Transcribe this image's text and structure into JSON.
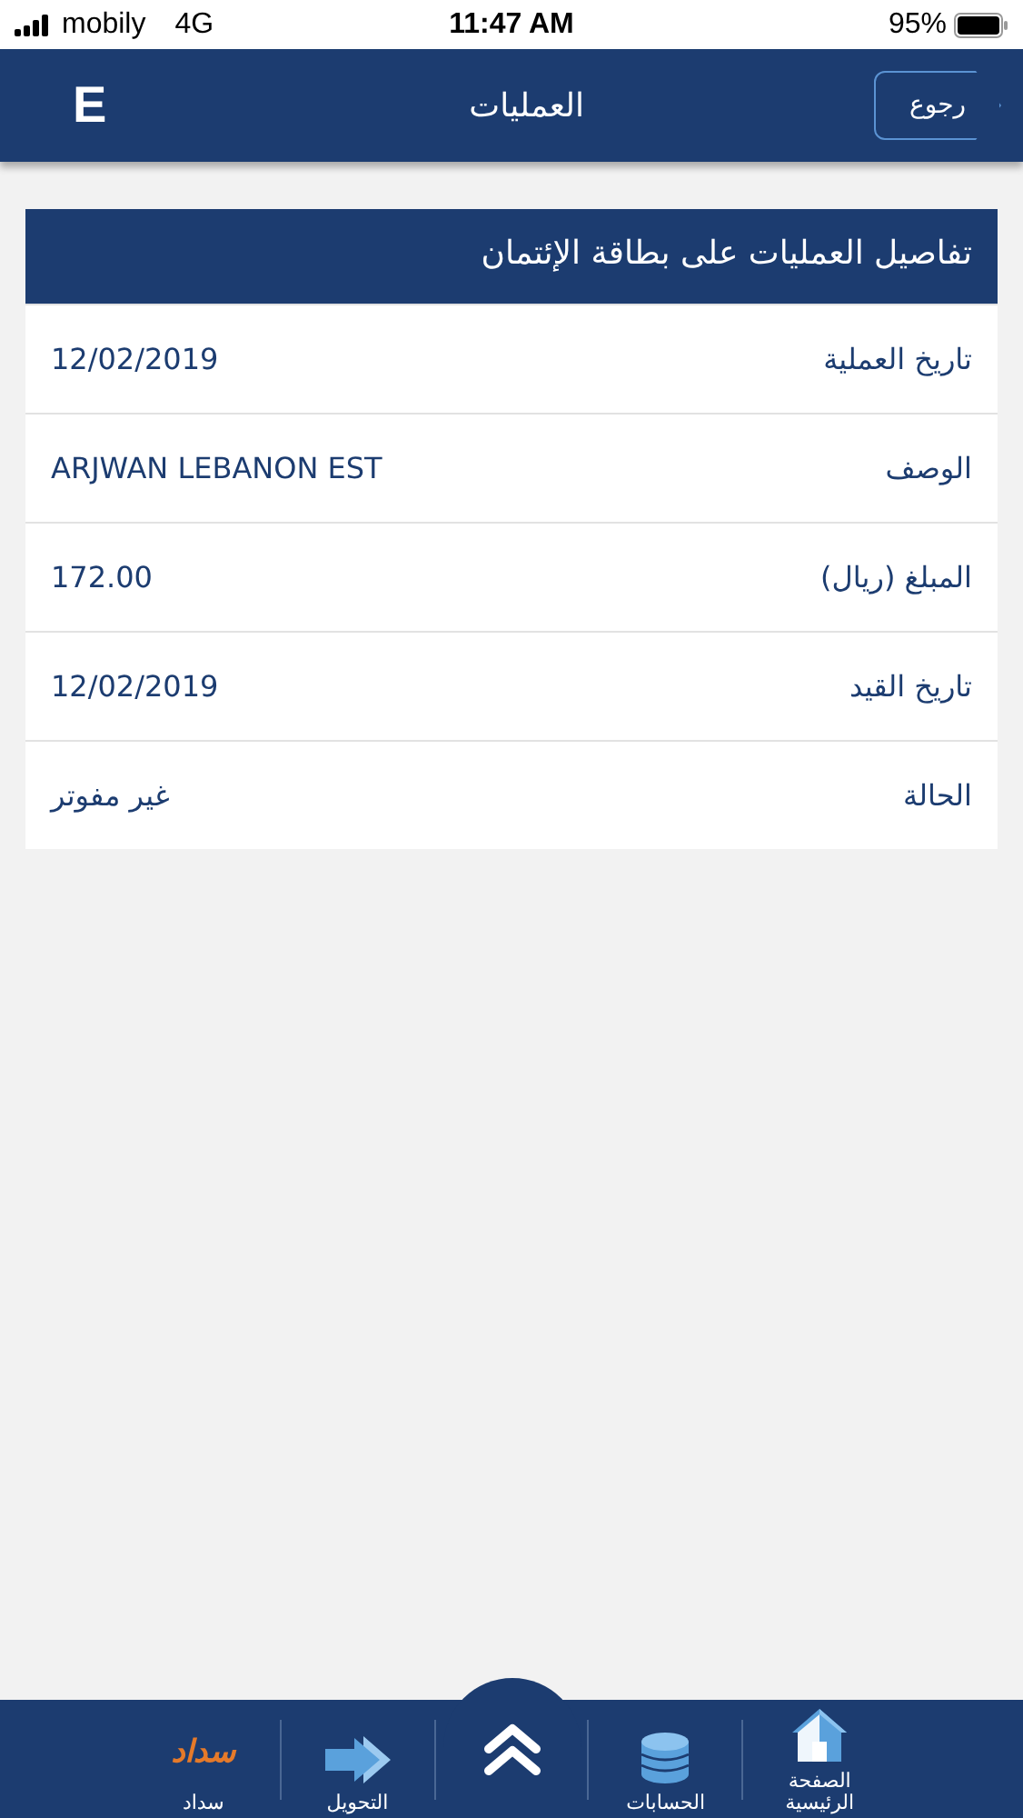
{
  "status_bar": {
    "carrier": "mobily",
    "network": "4G",
    "time": "11:47 AM",
    "battery": "95%"
  },
  "header": {
    "logo": "E",
    "title": "العمليات",
    "back_button": "رجوع"
  },
  "card": {
    "title": "تفاصيل العمليات على بطاقة الإئتمان",
    "rows": [
      {
        "label": "تاريخ العملية",
        "value": "12/02/2019"
      },
      {
        "label": "الوصف",
        "value": "ARJWAN LEBANON EST"
      },
      {
        "label": "المبلغ (ريال)",
        "value": "172.00"
      },
      {
        "label": "تاريخ القيد",
        "value": "12/02/2019"
      },
      {
        "label": "الحالة",
        "value": "غير مفوتر"
      }
    ]
  },
  "bottom_nav": [
    {
      "kind": "home",
      "label": "الصفحة الرئيسية"
    },
    {
      "kind": "accounts",
      "label": "الحسابات"
    },
    {
      "kind": "up"
    },
    {
      "kind": "transfer",
      "label": "التحويل"
    },
    {
      "kind": "sadad",
      "logo": "سداد",
      "label": "سداد"
    }
  ]
}
